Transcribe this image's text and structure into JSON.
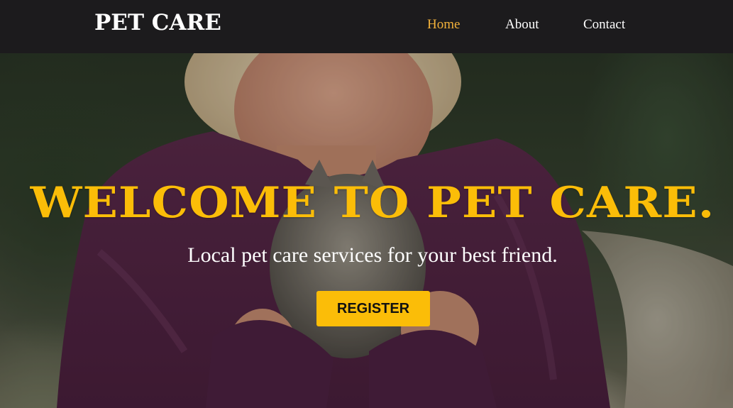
{
  "navbar": {
    "brand": "PET CARE",
    "links": [
      {
        "label": "Home",
        "active": true
      },
      {
        "label": "About",
        "active": false
      },
      {
        "label": "Contact",
        "active": false
      }
    ]
  },
  "hero": {
    "title": "WELCOME TO PET CARE.",
    "subtitle": "Local pet care services for your best friend.",
    "cta_label": "REGISTER",
    "background_image": "woman-holding-kitten-photo"
  },
  "colors": {
    "navbar_bg": "#1c1b1d",
    "accent": "#fbbd08",
    "active_link": "#f2b13a",
    "text_light": "#ffffff"
  }
}
